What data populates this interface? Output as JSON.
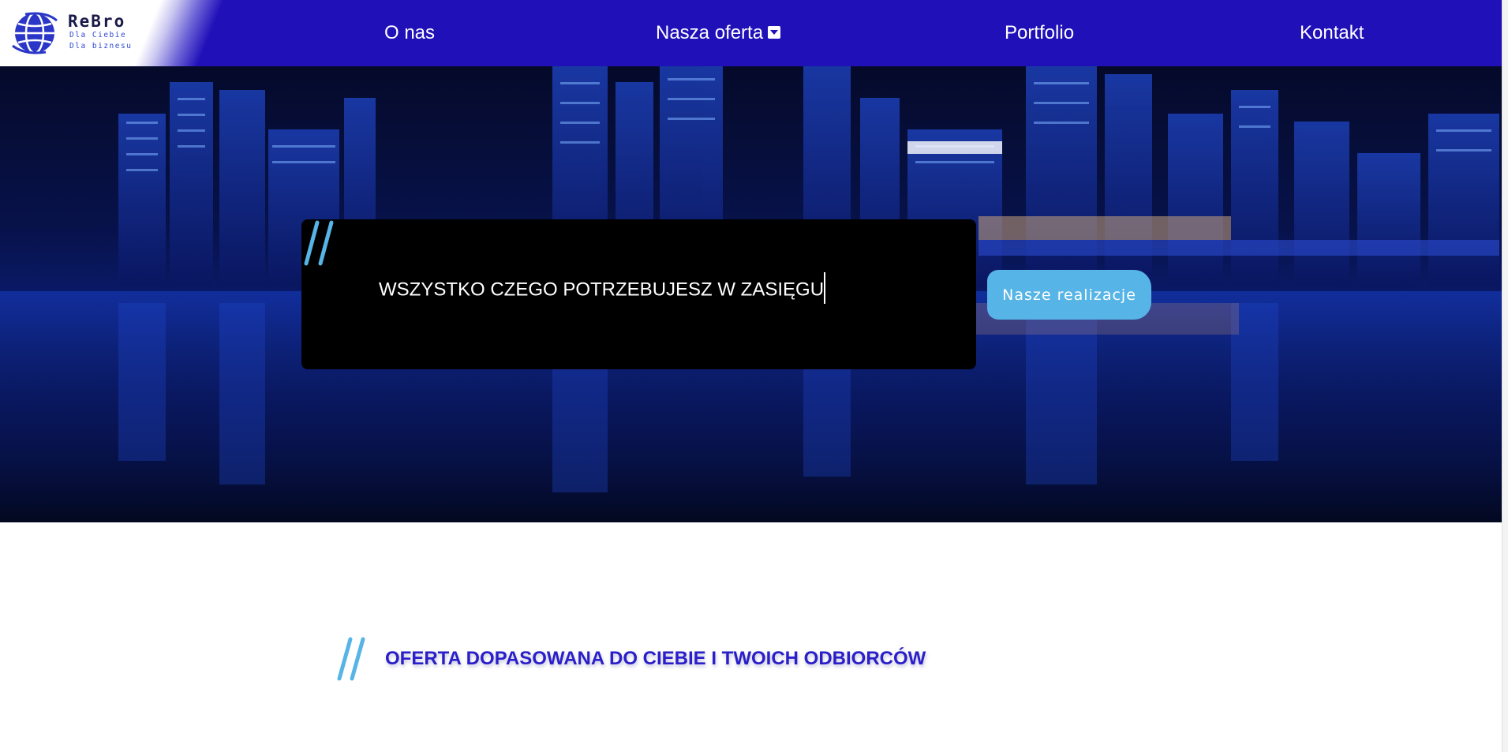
{
  "brand": {
    "name": "ReBro",
    "tagline_line1": "Dla Ciebie",
    "tagline_line2": "Dla biznesu",
    "colors": {
      "nav_bg": "#2010b8",
      "accent": "#56b4e6",
      "heading": "#2a1fc9"
    }
  },
  "nav": {
    "items": [
      {
        "label": "O nas"
      },
      {
        "label": "Nasza oferta",
        "has_dropdown": true
      },
      {
        "label": "Portfolio"
      },
      {
        "label": "Kontakt"
      }
    ]
  },
  "hero": {
    "typed_text": "WSZYSTKO CZEGO POTRZEBUJESZ W ZASIĘGU",
    "cta_label": "Nasze realizacje"
  },
  "section": {
    "heading": "OFERTA DOPASOWANA DO CIEBIE I TWOICH ODBIORCÓW"
  },
  "icons": {
    "logo": "globe-icon",
    "dropdown": "caret-down-icon",
    "decor": "double-slash-icon"
  }
}
